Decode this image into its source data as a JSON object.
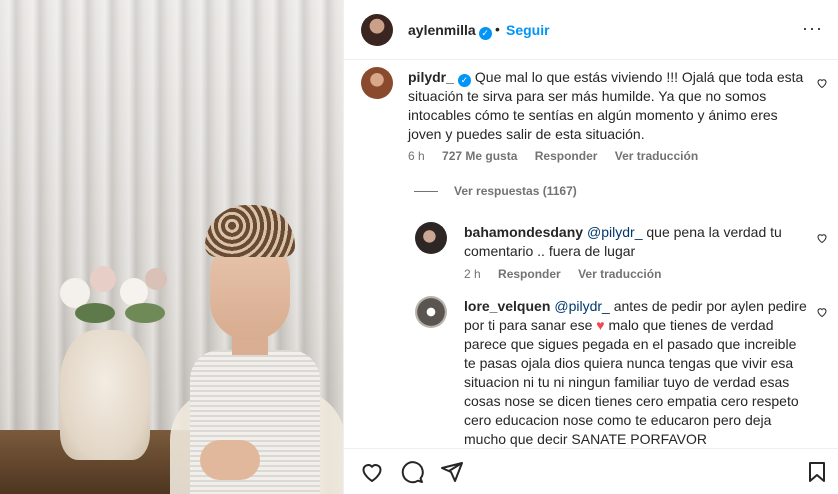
{
  "header": {
    "username": "aylenmilla",
    "separator": "•",
    "follow_label": "Seguir",
    "more_label": "···"
  },
  "comments": [
    {
      "username": "pilydr_",
      "verified": true,
      "text": "Que mal lo que estás viviendo !!! Ojalá que toda esta situación te sirva para ser más humilde. Ya que no somos intocables cómo te sentías en algún momento y ánimo eres joven y puedes salir de esta situación.",
      "time": "6 h",
      "likes": "727 Me gusta",
      "reply_label": "Responder",
      "translate_label": "Ver traducción"
    }
  ],
  "view_replies_label": "Ver respuestas (1167)",
  "replies": [
    {
      "username": "bahamondesdany",
      "mention": "@pilydr_",
      "text": "que pena la verdad tu comentario .. fuera de lugar",
      "time": "2 h",
      "reply_label": "Responder",
      "translate_label": "Ver traducción"
    },
    {
      "username": "lore_velquen",
      "mention": "@pilydr_",
      "text_before": "antes de pedir por aylen pedire por ti para sanar ese",
      "emoji": "♥",
      "text_after": "malo que tienes de verdad parece que sigues pegada en el pasado que increible te pasas ojala dios quiera nunca tengas que vivir esa situacion ni tu ni ningun familiar tuyo de verdad esas cosas nose se dicen tienes cero empatia cero respeto cero educacion nose como te educaron pero deja mucho que decir SANATE PORFAVOR"
    }
  ],
  "icons": {
    "verified": "verified-badge-icon",
    "heart": "heart-icon",
    "comment": "comment-icon",
    "share": "share-icon",
    "bookmark": "bookmark-icon"
  },
  "colors": {
    "accent": "#0095f6",
    "text": "#262626",
    "secondary": "#737373",
    "mention": "#00376b",
    "emoji_heart": "#ed4956"
  }
}
